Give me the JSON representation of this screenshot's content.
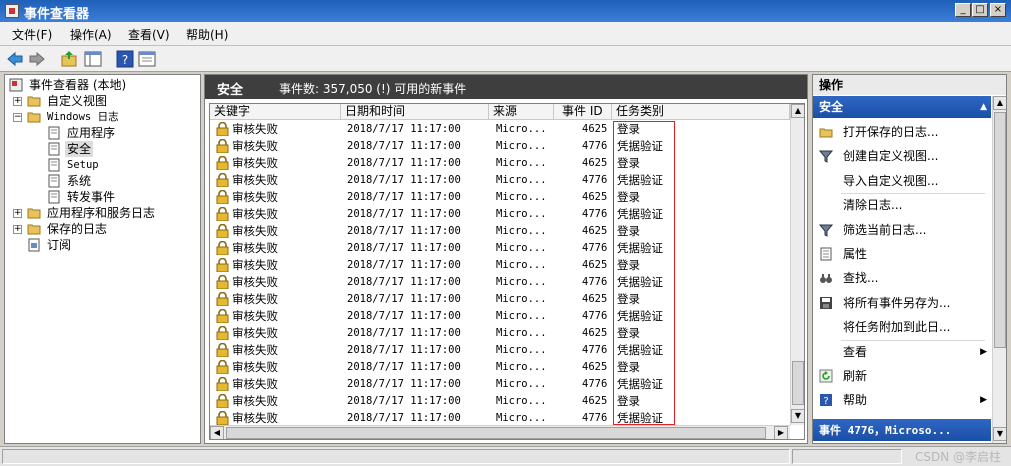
{
  "window": {
    "title": "事件查看器",
    "min_label": "_",
    "max_label": "□",
    "close_label": "×"
  },
  "menu": [
    "文件(F)",
    "操作(A)",
    "查看(V)",
    "帮助(H)"
  ],
  "toolbar": {
    "icons": [
      "back-arrow-icon",
      "forward-arrow-icon",
      "up-folder-icon",
      "show-hide-tree-icon",
      "help-icon",
      "properties-icon"
    ]
  },
  "tree": {
    "root": "事件查看器 (本地)",
    "custom_views": "自定义视图",
    "windows_logs": "Windows 日志",
    "application": "应用程序",
    "security": "安全",
    "setup": "Setup",
    "system": "系统",
    "forwarded": "转发事件",
    "apps_services": "应用程序和服务日志",
    "saved_logs": "保存的日志",
    "subscriptions": "订阅"
  },
  "center": {
    "title": "安全",
    "event_count": "事件数: 357,050 (!) 可用的新事件",
    "columns": [
      "关键字",
      "日期和时间",
      "来源",
      "事件 ID",
      "任务类别"
    ],
    "rows": [
      {
        "keyword": "审核失败",
        "datetime": "2018/7/17 11:17:00",
        "source": "Micro...",
        "event_id": "4625",
        "category": "登录"
      },
      {
        "keyword": "审核失败",
        "datetime": "2018/7/17 11:17:00",
        "source": "Micro...",
        "event_id": "4776",
        "category": "凭据验证"
      },
      {
        "keyword": "审核失败",
        "datetime": "2018/7/17 11:17:00",
        "source": "Micro...",
        "event_id": "4625",
        "category": "登录"
      },
      {
        "keyword": "审核失败",
        "datetime": "2018/7/17 11:17:00",
        "source": "Micro...",
        "event_id": "4776",
        "category": "凭据验证"
      },
      {
        "keyword": "审核失败",
        "datetime": "2018/7/17 11:17:00",
        "source": "Micro...",
        "event_id": "4625",
        "category": "登录"
      },
      {
        "keyword": "审核失败",
        "datetime": "2018/7/17 11:17:00",
        "source": "Micro...",
        "event_id": "4776",
        "category": "凭据验证"
      },
      {
        "keyword": "审核失败",
        "datetime": "2018/7/17 11:17:00",
        "source": "Micro...",
        "event_id": "4625",
        "category": "登录"
      },
      {
        "keyword": "审核失败",
        "datetime": "2018/7/17 11:17:00",
        "source": "Micro...",
        "event_id": "4776",
        "category": "凭据验证"
      },
      {
        "keyword": "审核失败",
        "datetime": "2018/7/17 11:17:00",
        "source": "Micro...",
        "event_id": "4625",
        "category": "登录"
      },
      {
        "keyword": "审核失败",
        "datetime": "2018/7/17 11:17:00",
        "source": "Micro...",
        "event_id": "4776",
        "category": "凭据验证"
      },
      {
        "keyword": "审核失败",
        "datetime": "2018/7/17 11:17:00",
        "source": "Micro...",
        "event_id": "4625",
        "category": "登录"
      },
      {
        "keyword": "审核失败",
        "datetime": "2018/7/17 11:17:00",
        "source": "Micro...",
        "event_id": "4776",
        "category": "凭据验证"
      },
      {
        "keyword": "审核失败",
        "datetime": "2018/7/17 11:17:00",
        "source": "Micro...",
        "event_id": "4625",
        "category": "登录"
      },
      {
        "keyword": "审核失败",
        "datetime": "2018/7/17 11:17:00",
        "source": "Micro...",
        "event_id": "4776",
        "category": "凭据验证"
      },
      {
        "keyword": "审核失败",
        "datetime": "2018/7/17 11:17:00",
        "source": "Micro...",
        "event_id": "4625",
        "category": "登录"
      },
      {
        "keyword": "审核失败",
        "datetime": "2018/7/17 11:17:00",
        "source": "Micro...",
        "event_id": "4776",
        "category": "凭据验证"
      },
      {
        "keyword": "审核失败",
        "datetime": "2018/7/17 11:17:00",
        "source": "Micro...",
        "event_id": "4625",
        "category": "登录"
      },
      {
        "keyword": "审核失败",
        "datetime": "2018/7/17 11:17:00",
        "source": "Micro...",
        "event_id": "4776",
        "category": "凭据验证"
      }
    ]
  },
  "actions": {
    "title": "操作",
    "section": "安全",
    "items": [
      {
        "label": "打开保存的日志...",
        "icon": "open-folder-icon"
      },
      {
        "label": "创建自定义视图...",
        "icon": "filter-icon"
      },
      {
        "label": "导入自定义视图...",
        "icon": ""
      },
      {
        "label": "清除日志...",
        "icon": ""
      },
      {
        "label": "筛选当前日志...",
        "icon": "filter-icon"
      },
      {
        "label": "属性",
        "icon": "properties-icon"
      },
      {
        "label": "查找...",
        "icon": "binoculars-icon"
      },
      {
        "label": "将所有事件另存为...",
        "icon": "save-icon"
      },
      {
        "label": "将任务附加到此日...",
        "icon": ""
      },
      {
        "label": "查看",
        "icon": "",
        "submenu": true
      },
      {
        "label": "刷新",
        "icon": "refresh-icon"
      },
      {
        "label": "帮助",
        "icon": "help-icon",
        "submenu": true
      }
    ],
    "event_section": "事件 4776，Microso...",
    "collapse_glyph": "▲",
    "submenu_glyph": "▶"
  },
  "watermark": "CSDN @李启柱",
  "colors": {
    "titlebar": "#1e5fb8",
    "section_header": "#2f67c4",
    "highlight_box": "#e02020",
    "center_header": "#3e3e3e"
  }
}
